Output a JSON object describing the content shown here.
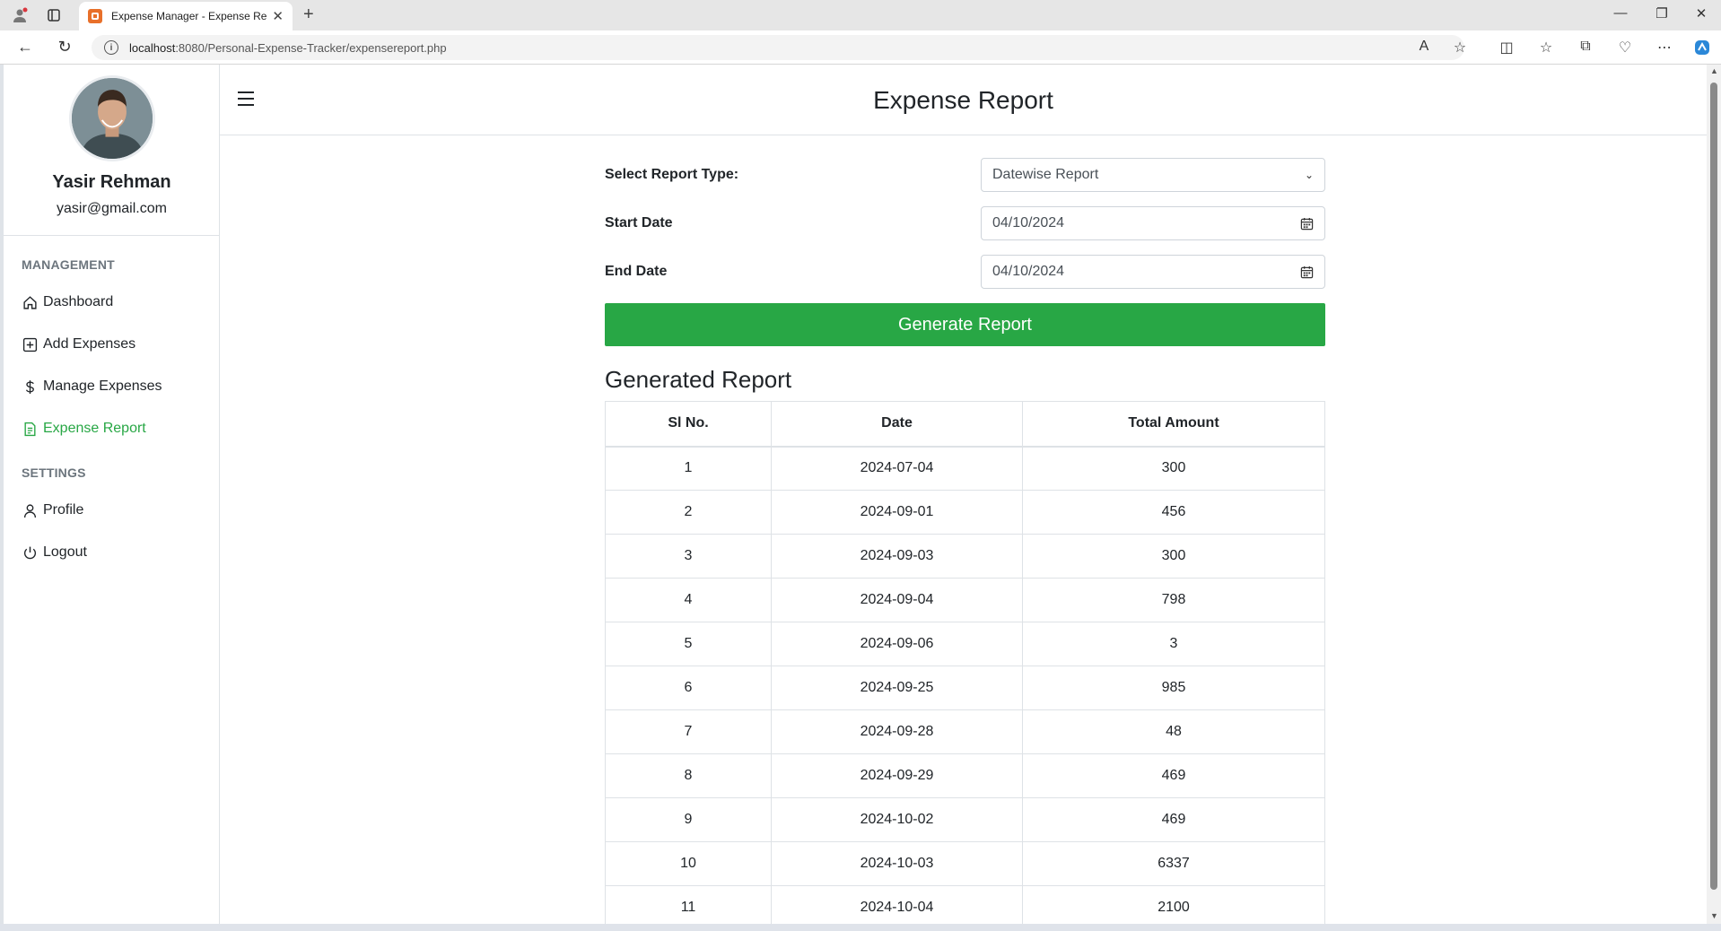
{
  "browser": {
    "tab_title": "Expense Manager - Expense Report",
    "url_host": "localhost",
    "url_rest": ":8080/Personal-Expense-Tracker/expensereport.php"
  },
  "sidebar": {
    "user_name": "Yasir Rehman",
    "user_email": "yasir@gmail.com",
    "section_management": "MANAGEMENT",
    "section_settings": "SETTINGS",
    "items": [
      {
        "label": "Dashboard",
        "icon": "home-icon"
      },
      {
        "label": "Add Expenses",
        "icon": "plus-square-icon"
      },
      {
        "label": "Manage Expenses",
        "icon": "dollar-icon"
      },
      {
        "label": "Expense Report",
        "icon": "file-text-icon",
        "active": true
      },
      {
        "label": "Profile",
        "icon": "user-icon"
      },
      {
        "label": "Logout",
        "icon": "power-icon"
      }
    ],
    "active_color": "#28a745"
  },
  "header": {
    "title": "Expense Report"
  },
  "form": {
    "report_type_label": "Select Report Type:",
    "report_type_value": "Datewise Report",
    "start_date_label": "Start Date",
    "start_date_value": "04/10/2024",
    "end_date_label": "End Date",
    "end_date_value": "04/10/2024",
    "generate_label": "Generate Report",
    "button_color": "#28a745"
  },
  "report": {
    "title": "Generated Report",
    "columns": [
      "Sl No.",
      "Date",
      "Total Amount"
    ],
    "rows": [
      [
        "1",
        "2024-07-04",
        "300"
      ],
      [
        "2",
        "2024-09-01",
        "456"
      ],
      [
        "3",
        "2024-09-03",
        "300"
      ],
      [
        "4",
        "2024-09-04",
        "798"
      ],
      [
        "5",
        "2024-09-06",
        "3"
      ],
      [
        "6",
        "2024-09-25",
        "985"
      ],
      [
        "7",
        "2024-09-28",
        "48"
      ],
      [
        "8",
        "2024-09-29",
        "469"
      ],
      [
        "9",
        "2024-10-02",
        "469"
      ],
      [
        "10",
        "2024-10-03",
        "6337"
      ],
      [
        "11",
        "2024-10-04",
        "2100"
      ]
    ]
  }
}
